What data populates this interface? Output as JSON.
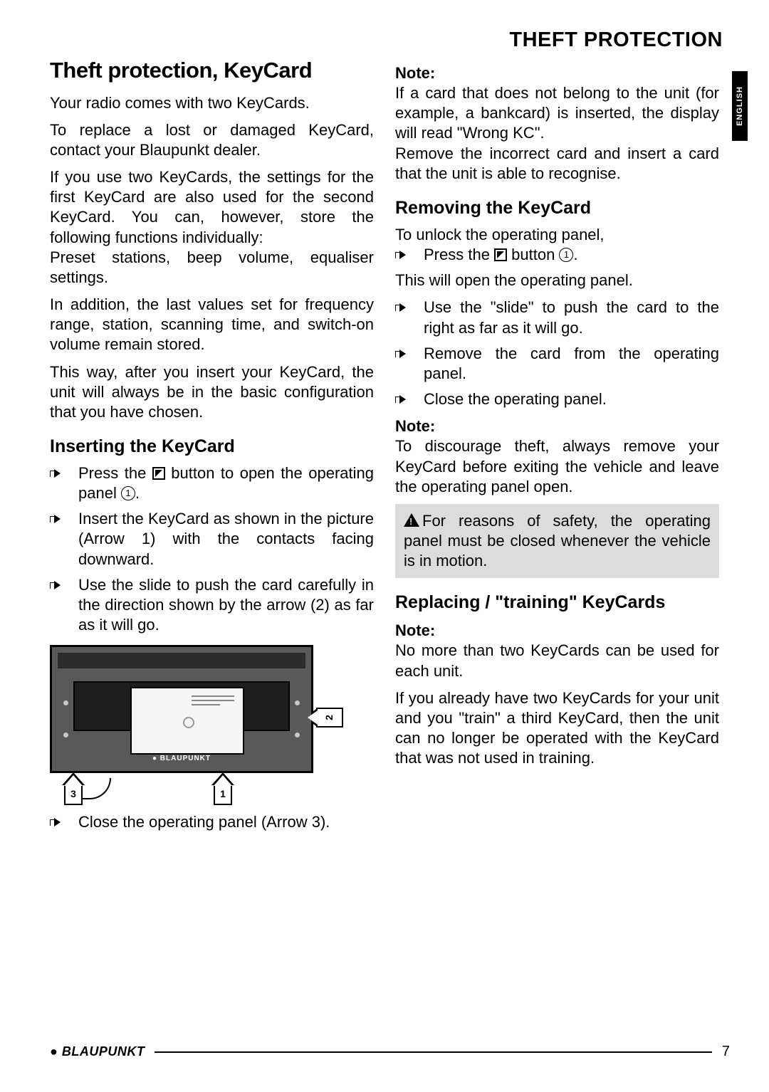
{
  "header": {
    "title": "THEFT PROTECTION",
    "language_tab": "ENGLISH"
  },
  "left": {
    "h1": "Theft protection, KeyCard",
    "p1": "Your radio comes with two KeyCards.",
    "p2": "To replace a lost or damaged KeyCard, contact your Blaupunkt dealer.",
    "p3": "If you use two KeyCards, the settings for the first KeyCard are also used for the second KeyCard. You can, however, store the following functions individually:",
    "p4": "Preset stations, beep volume, equaliser settings.",
    "p5": "In addition, the last values set for frequency range, station, scanning time, and switch-on volume remain stored.",
    "p6": "This way, after you insert your KeyCard, the unit will always be in the basic configuration that you have chosen.",
    "h2a": "Inserting the KeyCard",
    "b1a": "Press the ",
    "b1b": " button to open the operating panel ",
    "b1num": "1",
    "b2": "Insert the KeyCard as shown in the picture (Arrow 1) with the contacts facing downward.",
    "b3": "Use the slide to push the card carefully in the direction shown by the arrow (2) as far as it will go.",
    "b4": "Close the operating panel (Arrow 3).",
    "diagram": {
      "arrow1": "1",
      "arrow2": "2",
      "arrow3": "3",
      "brand": "BLAUPUNKT"
    }
  },
  "right": {
    "note1_h": "Note:",
    "note1_p1": "If a card that does not belong to the unit (for example, a bankcard) is inserted, the display will read \"Wrong KC\".",
    "note1_p2": "Remove the incorrect card and insert a card that the unit is able to recognise.",
    "h2a": "Removing the KeyCard",
    "p_unlock": "To unlock the operating panel,",
    "b1a": "Press the ",
    "b1b": " button ",
    "b1num": "1",
    "p_open": "This will open the operating panel.",
    "b2": "Use the \"slide\" to push the card to the right as far as it will go.",
    "b3": "Remove the card from the operating panel.",
    "b4": "Close the operating panel.",
    "note2_h": "Note:",
    "note2_p": "To discourage theft, always remove your KeyCard before exiting the vehicle and leave the operating panel open.",
    "warn": "For reasons of safety, the operating panel must be closed whenever the vehicle is in motion.",
    "h2b": "Replacing / \"training\" KeyCards",
    "note3_h": "Note:",
    "note3_p": "No more than two KeyCards can be used for each unit.",
    "p_last": "If you already have two KeyCards for your unit and you \"train\" a third KeyCard, then the unit can no longer be operated with the KeyCard that was not used in training."
  },
  "footer": {
    "brand": "BLAUPUNKT",
    "page": "7"
  }
}
